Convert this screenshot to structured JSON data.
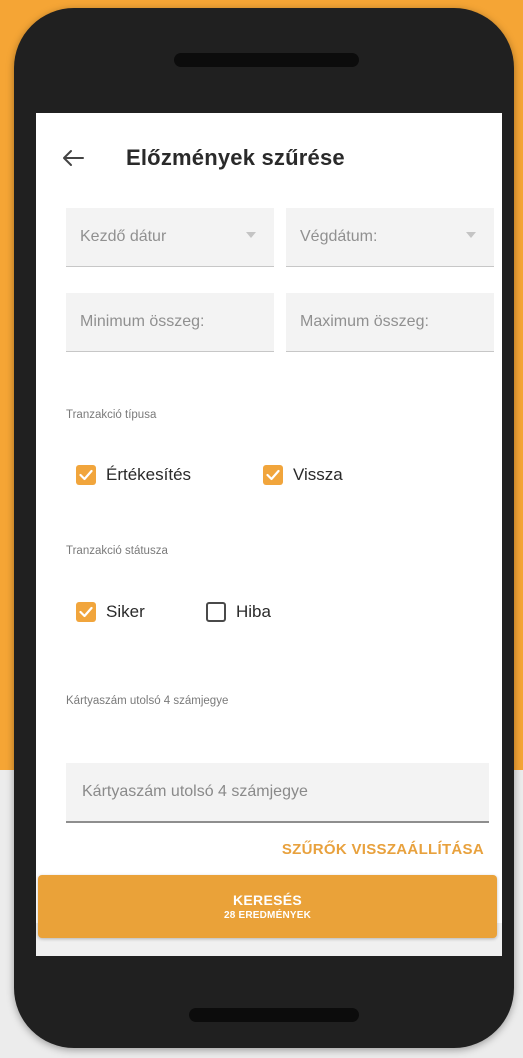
{
  "header": {
    "back_icon": "arrow-left-icon",
    "title": "Előzmények szűrése"
  },
  "dates": {
    "start_placeholder": "Kezdő dátur",
    "end_placeholder": "Végdátum:"
  },
  "amounts": {
    "min_placeholder": "Minimum összeg:",
    "max_placeholder": "Maximum összeg:"
  },
  "transaction_type": {
    "label": "Tranzakció típusa",
    "options": [
      {
        "label": "Értékesítés",
        "checked": true
      },
      {
        "label": "Vissza",
        "checked": true
      }
    ]
  },
  "transaction_status": {
    "label": "Tranzakció státusza",
    "options": [
      {
        "label": "Siker",
        "checked": true
      },
      {
        "label": "Hiba",
        "checked": false
      }
    ]
  },
  "card": {
    "label": "Kártyaszám utolsó 4 számjegye",
    "placeholder": "Kártyaszám utolsó 4 számjegye",
    "value": ""
  },
  "reset_label": "SZŰRŐK VISSZAÁLLÍTÁSA",
  "search": {
    "label": "KERESÉS",
    "results": "28 EREDMÉNYEK"
  },
  "colors": {
    "accent": "#f5a535",
    "checkbox": "#f1a53c"
  }
}
